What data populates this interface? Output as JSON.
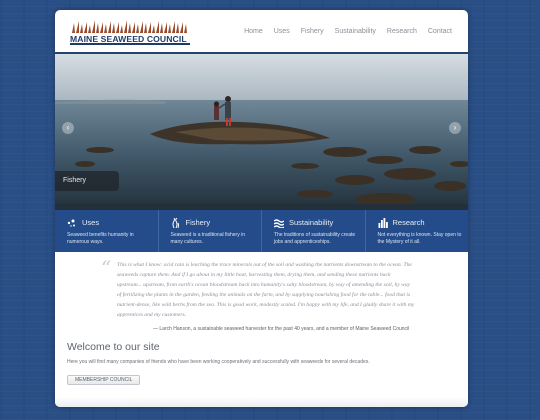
{
  "logo": {
    "text": "MAINE SEAWEED COUNCIL"
  },
  "nav": {
    "items": [
      "Home",
      "Uses",
      "Fishery",
      "Sustainability",
      "Research",
      "Contact"
    ]
  },
  "hero": {
    "caption": "Fishery",
    "prev_icon": "chevron-left-icon",
    "next_icon": "chevron-right-icon"
  },
  "features": [
    {
      "icon": "uses-icon",
      "title": "Uses",
      "text": "Seaweed benefits humanity in numerous ways."
    },
    {
      "icon": "seaweed-icon",
      "title": "Fishery",
      "text": "Seaweed is a traditional fishery in many cultures."
    },
    {
      "icon": "waves-icon",
      "title": "Sustainability",
      "text": "The traditions of sustainability create jobs and apprenticeships."
    },
    {
      "icon": "bar-chart-icon",
      "title": "Research",
      "text": "Not everything is known. Stay open to the Mystery of it all."
    }
  ],
  "quote": {
    "text": "This is what I know: acid rain is leaching the trace minerals out of the soil and washing the nutrients downstream to the ocean. The seaweeds capture them. And if I go about in my little boat, harvesting them, drying them, and sending these nutrients back upstream... upstream, from earth's ocean bloodstream back into humanity's salty bloodstream, by way of amending the soil, by way of fertilizing the plants in the garden, feeding the animals on the farm, and by supplying nourishing food for the table... food that is nutrient-dense, like wild herbs from the sea. This is good work, modestly scaled. I'm happy with my life, and I gladly share it with my apprentices and my customers.",
    "attribution": "— Larch Hanson, a sustainable seaweed harvester for the past 40 years, and a member of Maine Seaweed Council"
  },
  "welcome": {
    "title": "Welcome to our site",
    "text": "Here you will find many companies of friends who have been working cooperatively and successfully with seaweeds for several decades.",
    "button_label": "MEMBERSHIP COUNCIL"
  },
  "colors": {
    "brand": "#1f3c68",
    "feature_bar": "#244c8a",
    "background": "#2a4f86"
  }
}
